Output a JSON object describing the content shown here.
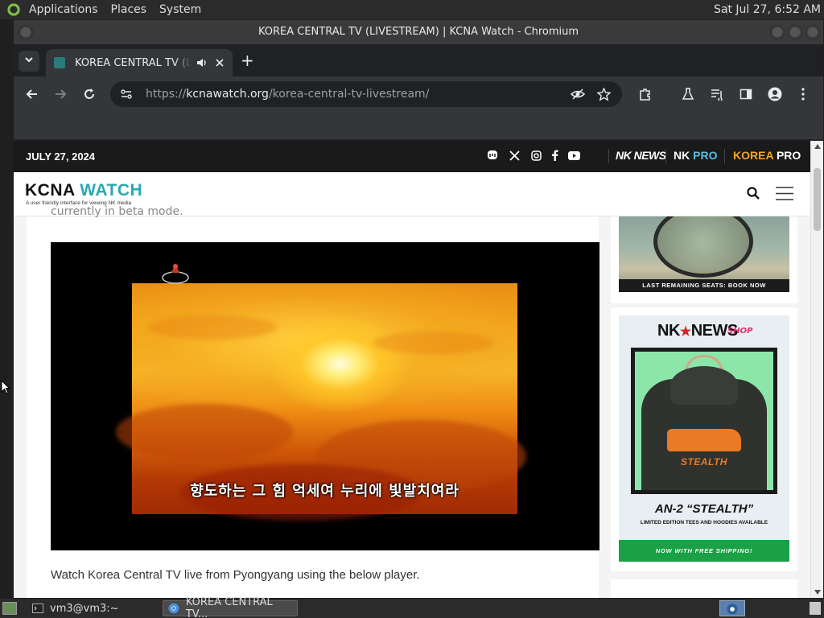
{
  "top_panel": {
    "menus": [
      "Applications",
      "Places",
      "System"
    ],
    "clock": "Sat Jul 27,  6:52 AM"
  },
  "window": {
    "title": "KOREA CENTRAL TV (LIVESTREAM) | KCNA Watch - Chromium"
  },
  "tab": {
    "title": "KOREA CENTRAL TV (LIVESTREAM) | KCNA Watch",
    "audio_icon": "speaker-icon",
    "close_icon": "close-icon"
  },
  "omnibox": {
    "scheme": "https://",
    "host": "kcnawatch.org",
    "path": "/korea-central-tv-livestream/"
  },
  "site": {
    "date": "JULY 27, 2024",
    "social_icons": [
      "mastodon-icon",
      "x-icon",
      "instagram-icon",
      "facebook-icon",
      "youtube-icon"
    ],
    "brands": {
      "nknews": "NK NEWS",
      "nkpro_a": "NK ",
      "nkpro_b": "PRO",
      "koreapro_a": "KOREA ",
      "koreapro_b": "PRO"
    },
    "logo_a": "KCNA ",
    "logo_b": "WATCH",
    "tagline": "A user friendly interface for viewing NK media"
  },
  "article": {
    "cut_text": "currently in beta mode.",
    "video_subtitle": "향도하는 그 힘 억세여 누리에 빛발치여라",
    "body_text": "Watch Korea Central TV live from Pyongyang using the below player."
  },
  "ads": {
    "seats_band": "LAST REMAINING SEATS: BOOK NOW",
    "nk_logo_a": "NK",
    "nk_logo_star": "★",
    "nk_logo_b": "NEWS",
    "shop": "SHOP",
    "print": "STEALTH",
    "title": "AN-2 “STEALTH”",
    "subtitle": "LIMITED EDITION TEES AND HOODIES AVAILABLE",
    "shipping": "NOW WITH FREE SHIPPING!"
  },
  "taskbar": {
    "items": [
      "vm3@vm3:~",
      "KOREA CENTRAL TV..."
    ]
  },
  "colors": {
    "accent_teal": "#2ba8b0",
    "koreapro_orange": "#f5a623",
    "shipping_green": "#1aa045"
  }
}
